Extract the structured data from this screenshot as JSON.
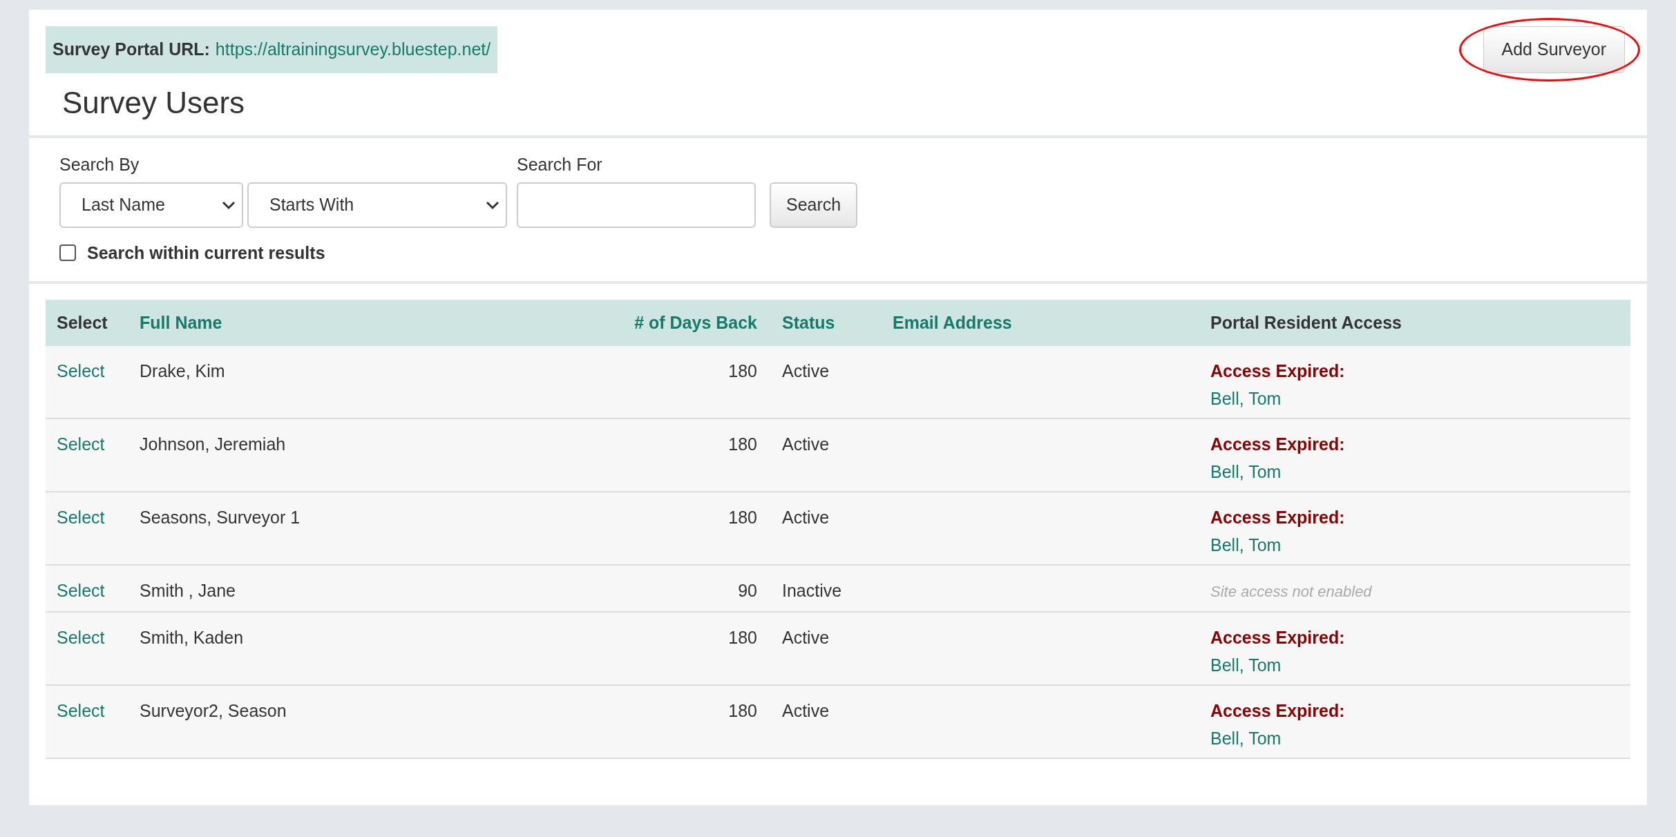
{
  "portal": {
    "label": "Survey Portal URL:",
    "url": "https://altrainingsurvey.bluestep.net/"
  },
  "add_button": "Add Surveyor",
  "annotation": {
    "kind": "ellipse"
  },
  "title": "Survey Users",
  "search": {
    "by_label": "Search By",
    "field": "Last Name",
    "match": "Starts With",
    "for_label": "Search For",
    "button": "Search",
    "within": {
      "label": "Search within current results",
      "checked": false
    }
  },
  "table": {
    "columns": [
      {
        "label": "Select",
        "sortable": false
      },
      {
        "label": "Full Name",
        "sortable": true
      },
      {
        "label": "# of Days Back",
        "sortable": true
      },
      {
        "label": "Status",
        "sortable": true
      },
      {
        "label": "Email Address",
        "sortable": true
      },
      {
        "label": "Portal Resident Access",
        "sortable": false
      }
    ],
    "rows": [
      {
        "select": "Select",
        "name": "Drake, Kim",
        "days": "180",
        "status": "Active",
        "access": {
          "kind": "expired",
          "label": "Access Expired:",
          "by": "Bell, Tom"
        }
      },
      {
        "select": "Select",
        "name": "Johnson, Jeremiah",
        "days": "180",
        "status": "Active",
        "access": {
          "kind": "expired",
          "label": "Access Expired:",
          "by": "Bell, Tom"
        }
      },
      {
        "select": "Select",
        "name": "Seasons, Surveyor 1",
        "days": "180",
        "status": "Active",
        "access": {
          "kind": "expired",
          "label": "Access Expired:",
          "by": "Bell, Tom"
        }
      },
      {
        "select": "Select",
        "name": "Smith , Jane",
        "days": "90",
        "status": "Inactive",
        "access": {
          "kind": "disabled",
          "label": "Site access not enabled"
        }
      },
      {
        "select": "Select",
        "name": "Smith, Kaden",
        "days": "180",
        "status": "Active",
        "access": {
          "kind": "expired",
          "label": "Access Expired:",
          "by": "Bell, Tom"
        }
      },
      {
        "select": "Select",
        "name": "Surveyor2, Season",
        "days": "180",
        "status": "Active",
        "access": {
          "kind": "expired",
          "label": "Access Expired:",
          "by": "Bell, Tom"
        }
      }
    ]
  }
}
